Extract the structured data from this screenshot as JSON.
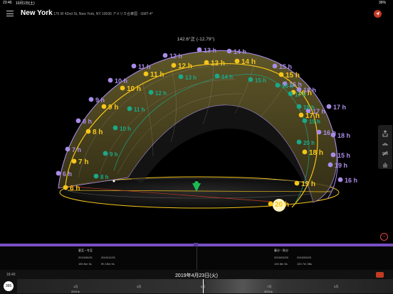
{
  "status_bar": {
    "time": "23:46",
    "date": "10月1日(土)",
    "battery": "36%"
  },
  "header": {
    "city": "New York",
    "address": "175 W 42nd St, New York, NY 10036 アメリカ合衆国 · GMT-4*"
  },
  "readout": "142.6°正 (-12.79°)",
  "hour_labels": {
    "yellow": [
      "6 h",
      "7 h",
      "8 h",
      "9 h",
      "10 h",
      "11 h",
      "12 h",
      "13 h",
      "14 h",
      "15 h",
      "16 h",
      "17 h",
      "18 h",
      "19 h",
      "20 h"
    ],
    "purple": [
      "6 h",
      "7 h",
      "8 h",
      "9 h",
      "10 h",
      "11 h",
      "12 h",
      "13 h",
      "14 h",
      "15 h",
      "16 h",
      "17 h",
      "18 h",
      "19 h"
    ],
    "green": [
      "8 h",
      "9 h",
      "10 h",
      "11 h",
      "12 h",
      "13 h",
      "14 h",
      "15 h",
      "16 h",
      "17 h",
      "18 h",
      "19 h",
      "20 h"
    ],
    "purple_right": [
      "15 h",
      "16 h",
      "17 h",
      "18 h",
      "16 h"
    ]
  },
  "colors": {
    "yellow": "#f5c518",
    "purple": "#a98ce8",
    "green": "#19a98a",
    "accent": "#c23b22",
    "bar": "#7a4fc4"
  },
  "table": {
    "left": {
      "header": "夏至・冬至",
      "dates": [
        "2019/06/21",
        "2019/12/21"
      ],
      "durations": [
        "15h 6m 3s",
        "9h 15m 0s"
      ]
    },
    "right": {
      "header": "春分・秋分",
      "dates": [
        "2019/03/20",
        "2019/09/23"
      ],
      "durations": [
        "12h 8m 5s",
        "12h 7m 38s"
      ]
    }
  },
  "footer": {
    "time": "18:40",
    "date": "2019年4月23日(火)",
    "mode_button": "365",
    "months": [
      "1月",
      "3月",
      "5月",
      "7月",
      "9月"
    ],
    "years": [
      "2019 ▸",
      "2019 ▸"
    ]
  },
  "icons": [
    "menu-icon",
    "location-arrow-icon",
    "share-icon",
    "sunrise-icon",
    "layers-icon",
    "hand-icon",
    "info-icon",
    "sun-ray-icon"
  ]
}
